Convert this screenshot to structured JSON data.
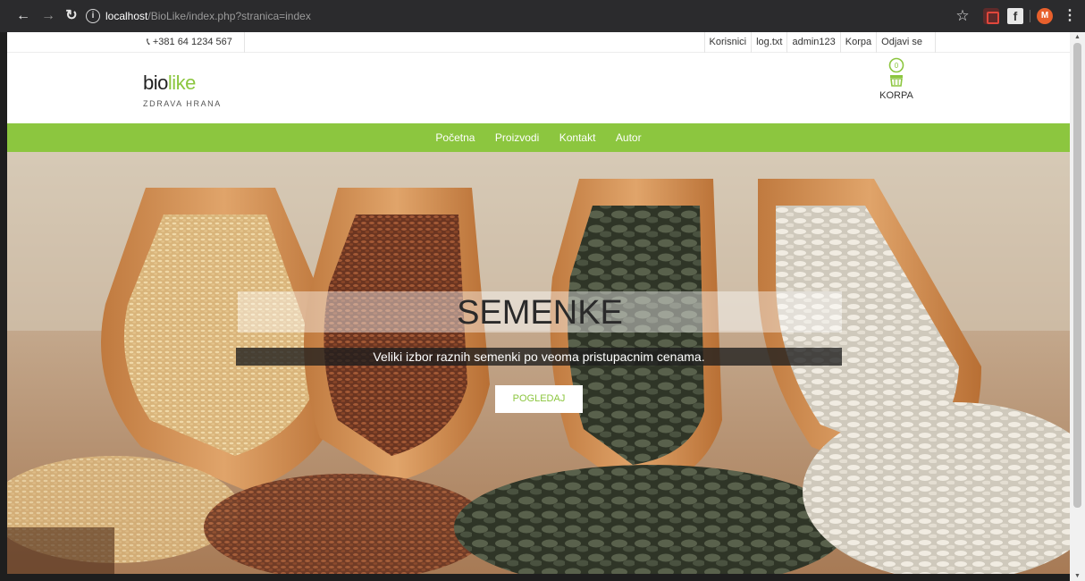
{
  "browser": {
    "url_host": "localhost",
    "url_path": "/BioLike/index.php?stranica=index",
    "profile_initial": "M"
  },
  "topbar": {
    "phone": "+381 64 1234 567",
    "links": [
      "Korisnici",
      "log.txt",
      "admin123",
      "Korpa",
      "Odjavi se"
    ]
  },
  "logo": {
    "part1": "bio",
    "part2": "like",
    "tagline": "ZDRAVA HRANA"
  },
  "cart": {
    "label": "KORPA"
  },
  "nav": [
    "Početna",
    "Proizvodi",
    "Kontakt",
    "Autor"
  ],
  "hero": {
    "title": "SEMENKE",
    "subtitle": "Veliki izbor raznih semenki po veoma pristupacnim cenama.",
    "button": "POGLEDAJ"
  },
  "colors": {
    "accent": "#8cc63f",
    "chrome": "#2b2b2d"
  }
}
